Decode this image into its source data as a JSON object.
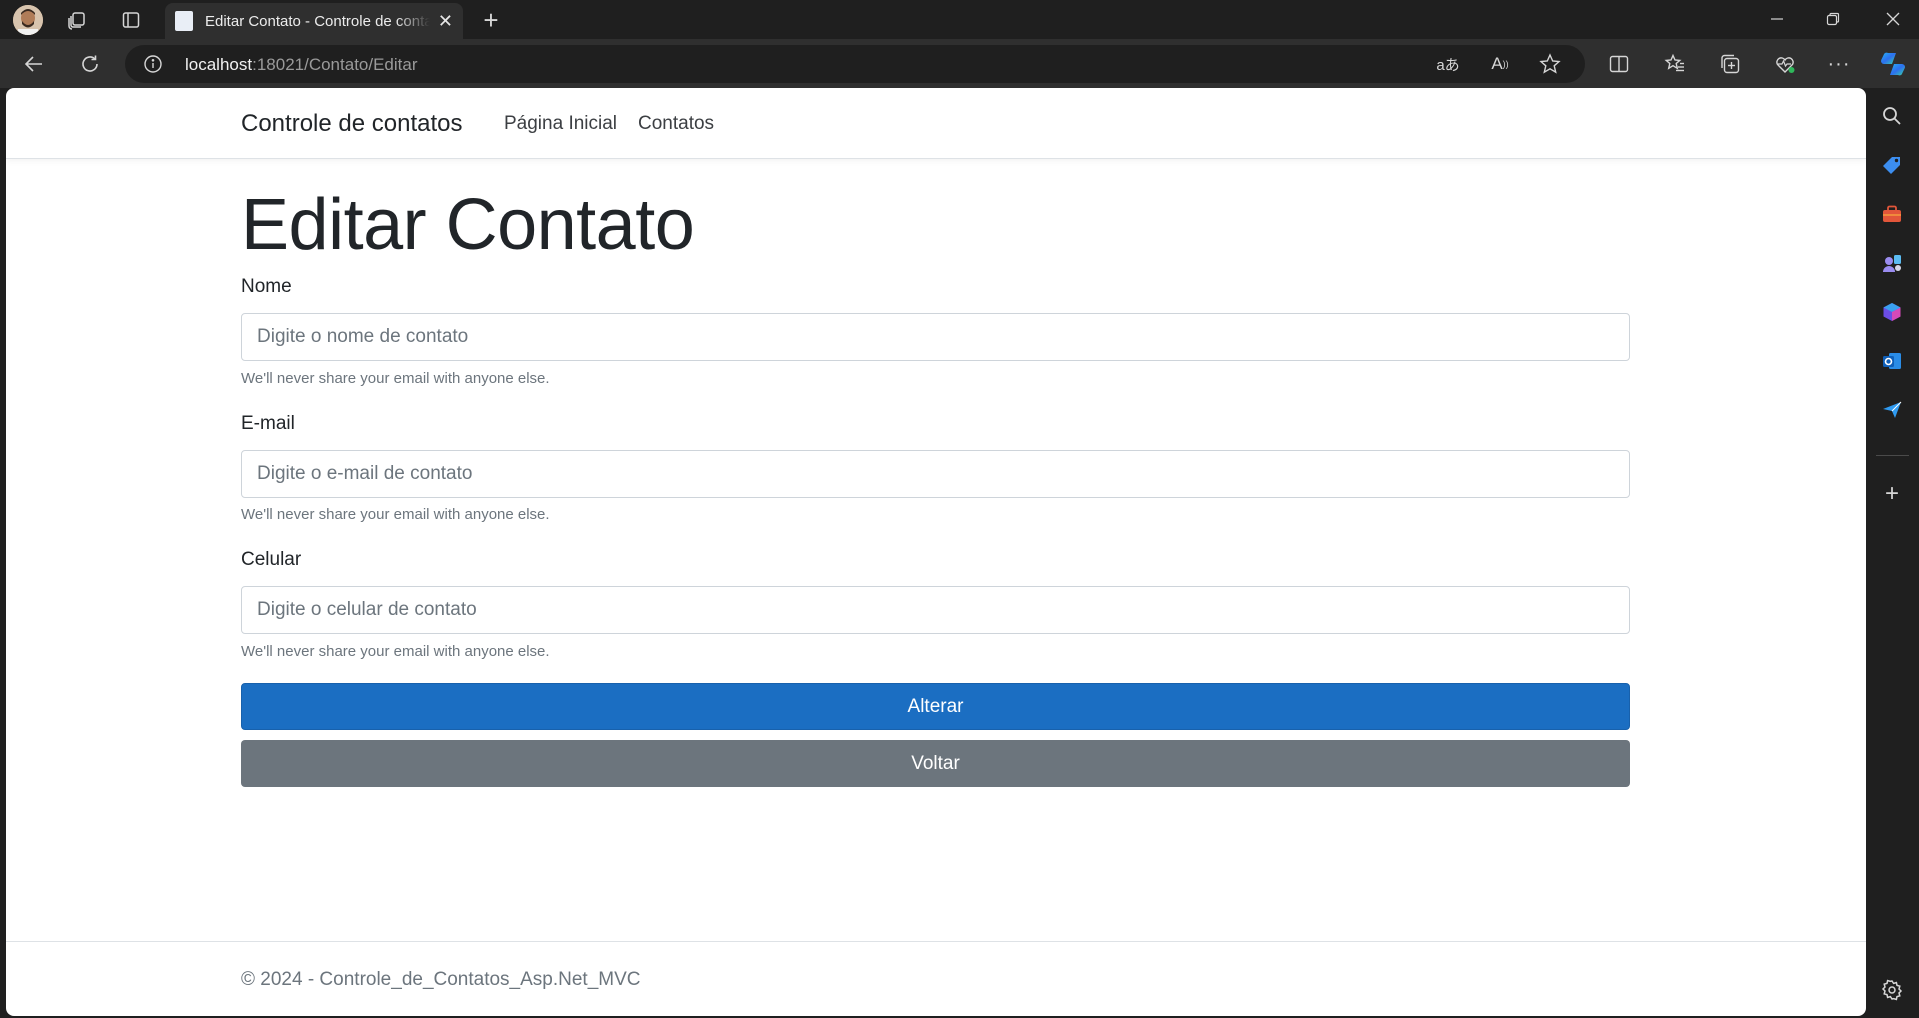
{
  "browser": {
    "tab_title": "Editar Contato - Controle de contatos",
    "url_host": "localhost",
    "url_rest": ":18021/Contato/Editar",
    "icons": [
      "profile-avatar",
      "workspaces-icon",
      "tab-actions-icon",
      "new-tab-icon",
      "minimize-icon",
      "restore-icon",
      "close-window-icon",
      "back-icon",
      "refresh-icon",
      "site-info-icon",
      "translate-icon",
      "read-aloud-icon",
      "favorite-star-icon",
      "split-screen-icon",
      "favorites-icon",
      "collections-icon",
      "browser-essentials-icon",
      "more-icon",
      "copilot-icon"
    ],
    "sidebar_icons": [
      "search-icon",
      "shopping-icon",
      "tools-icon",
      "games-icon",
      "microsoft-365-icon",
      "outlook-icon",
      "drop-icon",
      "add-icon",
      "settings-icon"
    ]
  },
  "navbar": {
    "brand": "Controle de contatos",
    "links": [
      "Página Inicial",
      "Contatos"
    ]
  },
  "form": {
    "title": "Editar Contato",
    "fields": [
      {
        "label": "Nome",
        "placeholder": "Digite o nome de contato",
        "help": "We'll never share your email with anyone else."
      },
      {
        "label": "E-mail",
        "placeholder": "Digite o e-mail de contato",
        "help": "We'll never share your email with anyone else."
      },
      {
        "label": "Celular",
        "placeholder": "Digite o celular de contato",
        "help": "We'll never share your email with anyone else."
      }
    ],
    "submit_label": "Alterar",
    "back_label": "Voltar"
  },
  "footer": {
    "text": "© 2024 - Controle_de_Contatos_Asp.Net_MVC"
  },
  "colors": {
    "primary": "#1b6ec2",
    "secondary": "#6c757d",
    "chrome_dark": "#1f1f1f",
    "chrome_toolbar": "#2f2f2f"
  }
}
